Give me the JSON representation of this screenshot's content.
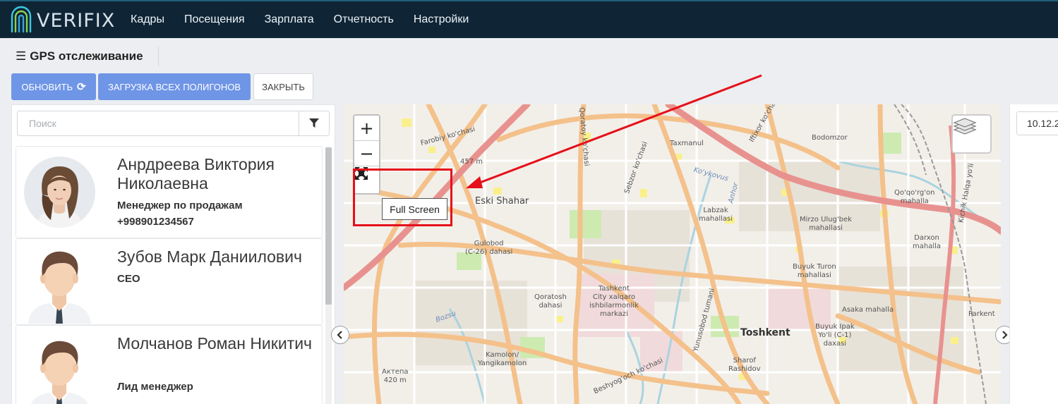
{
  "app": {
    "logo_text": "VERIFIX"
  },
  "nav": {
    "items": [
      {
        "label": "Кадры"
      },
      {
        "label": "Посещения"
      },
      {
        "label": "Зарплата"
      },
      {
        "label": "Отчетность"
      },
      {
        "label": "Настройки"
      }
    ]
  },
  "page": {
    "title": "GPS отслеживание",
    "menu_icon": "hamburger-icon"
  },
  "toolbar": {
    "refresh_label": "Обновить",
    "load_polygons_label": "Загрузка всех полигонов",
    "close_label": "Закрыть"
  },
  "search": {
    "placeholder": "Поиск",
    "value": ""
  },
  "employees": [
    {
      "name": "Анрдреева Виктория Николаевна",
      "position": "Менеджер по продажам",
      "phone": "+998901234567"
    },
    {
      "name": "Зубов Марк Даниилович",
      "position": "CEO",
      "phone": ""
    },
    {
      "name": "Молчанов Роман Никитич",
      "position": "Лид менеджер",
      "phone": ""
    }
  ],
  "map": {
    "zoom_in": "+",
    "zoom_out": "−",
    "tooltip": "Full Screen",
    "labels": {
      "farobiy": "Farobiy ko'chasi",
      "m457": "457 m",
      "qoratoy": "Qoratoy ko'chasi",
      "sebzor_ko": "Sebzor ko'chasi",
      "ifhor": "Iftixor ko'chasi",
      "taxmanul": "Taxmanul",
      "bodomzor": "Bodomzor",
      "koykovus": "Ko'ykovus",
      "anhor": "Anhor",
      "eski_shahar": "Eski Shahar",
      "labzak": "Labzak\nmahallasi",
      "qoqorgon": "Qo'qo'rg'on\nmahalla",
      "mirzo": "Mirzo Ulug'bek\nmahallasi",
      "darxon": "Darxon\nmahalla",
      "gulobod": "Gulobod\n(C-26) dahasi",
      "buyuk_turon": "Buyuk Turon\nmahallasi",
      "tashkent_city": "Tashkent\nCity xalqaro\nishbilarmonlik\nmarkazi",
      "qoratosh": "Qoratosh\ndahasi",
      "asaka": "Asaka mahalla",
      "parkent": "Parkent",
      "bozsu": "Bozsu",
      "yunusobod": "Yunusobod tumani",
      "toshkent": "Toshkent",
      "buyuk_ipak": "Buyuk Ipak\nYo'li (C-1)\ndaxasi",
      "kamolon": "Kamolon/\nYangikamolon",
      "sharof": "Sharof\nRashidov",
      "aktepa": "Актепа\n420 m",
      "beshyogoch": "Beshyog'och ko'chasi",
      "kichik_halqa": "Kichik Halqa yo'li"
    }
  },
  "right_panel": {
    "date_value": "10.12.2"
  },
  "colors": {
    "navbar": "#0f2536",
    "primary": "#6f95e6",
    "highlight": "#e5101a",
    "map_road_major": "#f4c18b",
    "map_road_trunk": "#e8928f"
  }
}
